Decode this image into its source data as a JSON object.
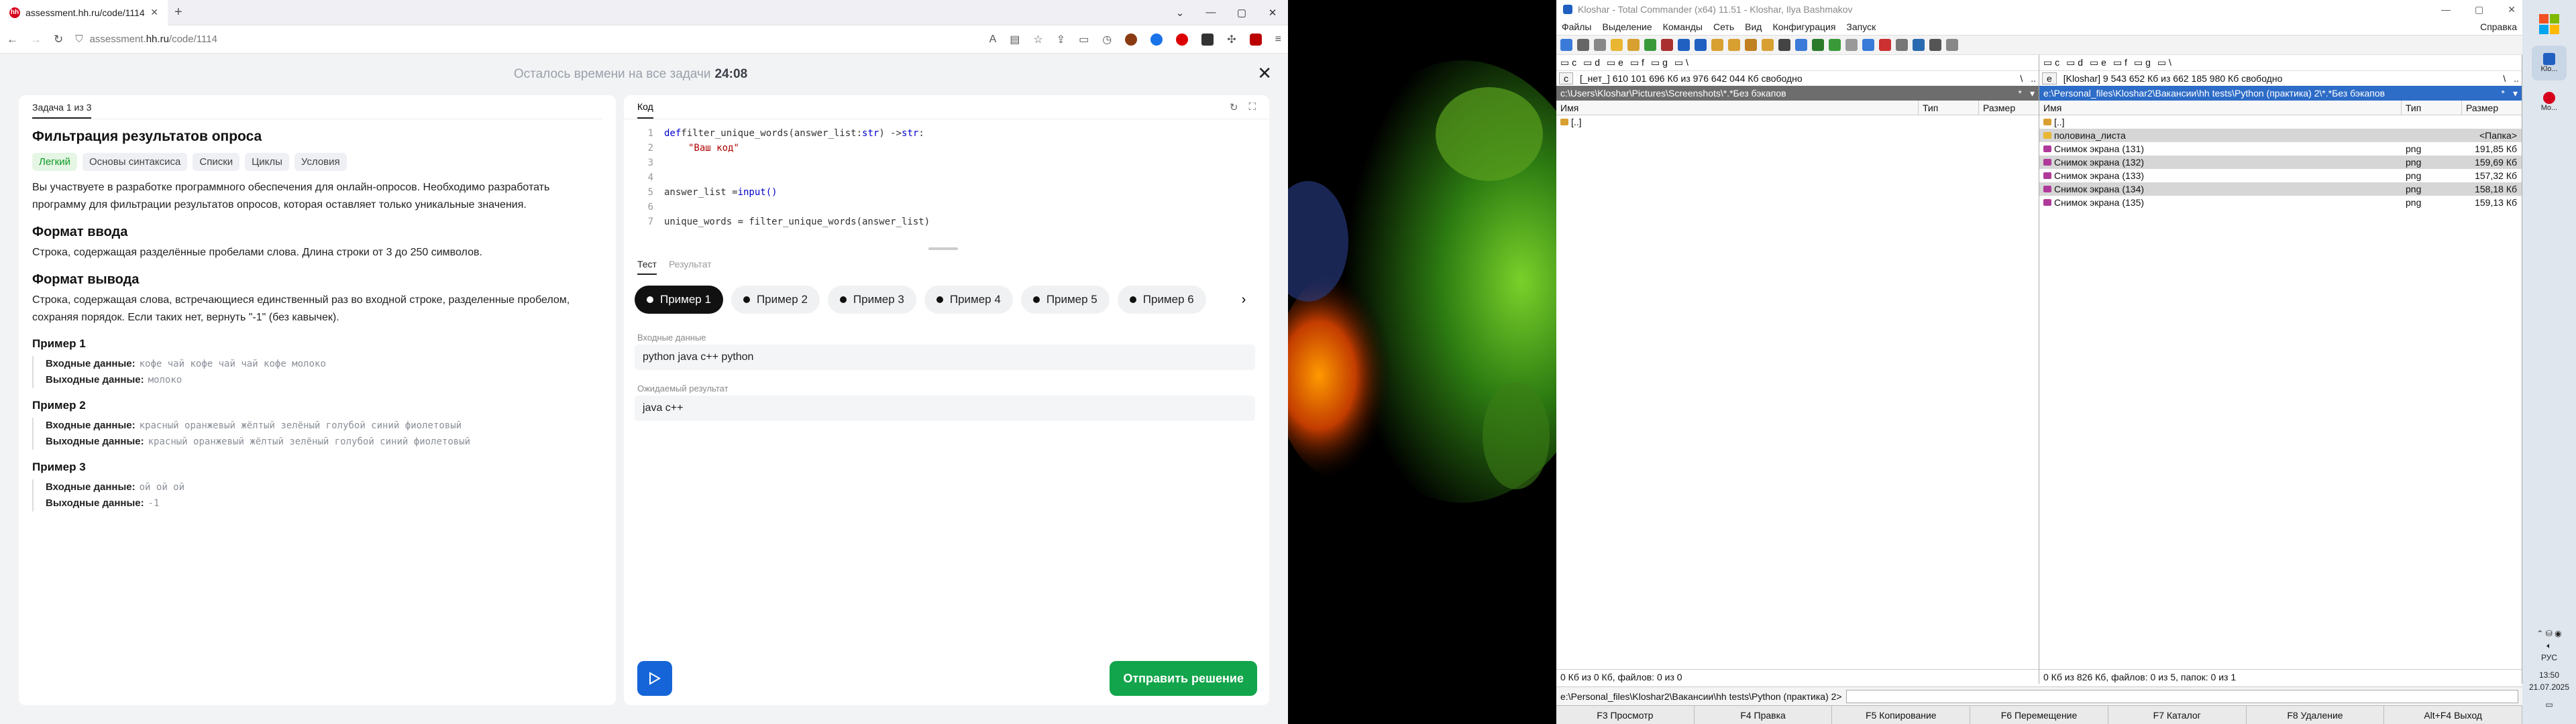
{
  "browser": {
    "tab_title": "assessment.hh.ru/code/1114",
    "url_prefix": "assessment.",
    "url_domain": "hh.ru",
    "url_path": "/code/1114"
  },
  "timer": {
    "label": "Осталось времени на все задачи",
    "value": "24:08"
  },
  "task": {
    "counter": "Задача 1 из 3",
    "title": "Фильтрация результатов опроса",
    "tags": [
      "Легкий",
      "Основы синтаксиса",
      "Списки",
      "Циклы",
      "Условия"
    ],
    "description": "Вы участвуете в разработке программного обеспечения для онлайн-опросов. Необходимо разработать программу для фильтрации результатов опросов, которая оставляет только уникальные значения.",
    "input_title": "Формат ввода",
    "input_text": "Строка, содержащая разделённые пробелами слова. Длина строки от 3 до 250 символов.",
    "output_title": "Формат вывода",
    "output_text": "Строка, содержащая слова, встречающиеся единственный раз во входной строке, разделенные пробелом, сохраняя порядок. Если таких нет, вернуть \"-1\" (без кавычек).",
    "in_label": "Входные данные:",
    "out_label": "Выходные данные:",
    "examples": [
      {
        "title": "Пример 1",
        "input": "кофе чай кофе чай чай кофе молоко",
        "output": "молоко"
      },
      {
        "title": "Пример 2",
        "input": "красный оранжевый жёлтый зелёный голубой синий фиолетовый",
        "output": "красный оранжевый жёлтый зелёный голубой синий фиолетовый"
      },
      {
        "title": "Пример 3",
        "input": "ой ой ой",
        "output": "-1"
      }
    ]
  },
  "code": {
    "tab_label": "Код",
    "line_numbers": [
      "1",
      "2",
      "3",
      "4",
      "5",
      "6",
      "7"
    ],
    "line1_kw": "def",
    "line1_rest": " filter_unique_words(answer_list: ",
    "line1_type1": "str",
    "line1_arrow": ") -> ",
    "line1_type2": "str",
    "line1_end": ":",
    "line2": "\"Ваш код\"",
    "line5_a": "answer_list = ",
    "line5_fn": "input()",
    "line7": "unique_words = filter_unique_words(answer_list)"
  },
  "tests": {
    "tab_test": "Тест",
    "tab_result": "Результат",
    "pills": [
      "Пример 1",
      "Пример 2",
      "Пример 3",
      "Пример 4",
      "Пример 5",
      "Пример 6"
    ],
    "input_label": "Входные данные",
    "input_value": "python java c++ python",
    "expected_label": "Ожидаемый результат",
    "expected_value": "java c++",
    "submit_label": "Отправить решение"
  },
  "tc": {
    "title": "Kloshar - Total Commander (x64) 11.51 - Kloshar, Ilya Bashmakov",
    "menu": [
      "Файлы",
      "Выделение",
      "Команды",
      "Сеть",
      "Вид",
      "Конфигурация",
      "Запуск"
    ],
    "menu_right": "Справка",
    "left": {
      "drive": "c",
      "info": "[_нет_]  610 101 696 Кб из 976 642 044 Кб свободно",
      "path": "c:\\Users\\Kloshar\\Pictures\\Screenshots\\*.*Без бэкапов",
      "up": "[..]",
      "status": "0 Кб из 0 Кб, файлов: 0 из 0"
    },
    "right": {
      "drive": "e",
      "info": "[Kloshar]  9 543 652 Кб из 662 185 980 Кб свободно",
      "path": "e:\\Personal_files\\Kloshar2\\Вакансии\\hh tests\\Python (практика) 2\\*.*Без бэкапов",
      "up": "[..]",
      "files": [
        {
          "name": "половина_листа",
          "type": "",
          "size": "<Папка>"
        },
        {
          "name": "Снимок экрана (131)",
          "type": "png",
          "size": "191,85 Кб"
        },
        {
          "name": "Снимок экрана (132)",
          "type": "png",
          "size": "159,69 Кб"
        },
        {
          "name": "Снимок экрана (133)",
          "type": "png",
          "size": "157,32 Кб"
        },
        {
          "name": "Снимок экрана (134)",
          "type": "png",
          "size": "158,18 Кб"
        },
        {
          "name": "Снимок экрана (135)",
          "type": "png",
          "size": "159,13 Кб"
        }
      ],
      "status": "0 Кб из 826 Кб, файлов: 0 из 5, папок: 0 из 1"
    },
    "col_name": "Имя",
    "col_type": "Тип",
    "col_size": "Размер",
    "cmd_path": "e:\\Personal_files\\Kloshar2\\Вакансии\\hh tests\\Python (практика) 2>",
    "fkeys": [
      "F3 Просмотр",
      "F4 Правка",
      "F5 Копирование",
      "F6 Перемещение",
      "F7 Каталог",
      "F8 Удаление",
      "Alt+F4 Выход"
    ]
  },
  "taskbar": {
    "app1": "Klo...",
    "app2": "Mo...",
    "lang": "РУС",
    "time": "13:50",
    "date": "21.07.2025"
  },
  "colors": {
    "accent_blue": "#1565d8",
    "submit_green": "#12a54b",
    "tag_green": "#0a9a25",
    "tc_active_path": "#2d6cc7"
  }
}
